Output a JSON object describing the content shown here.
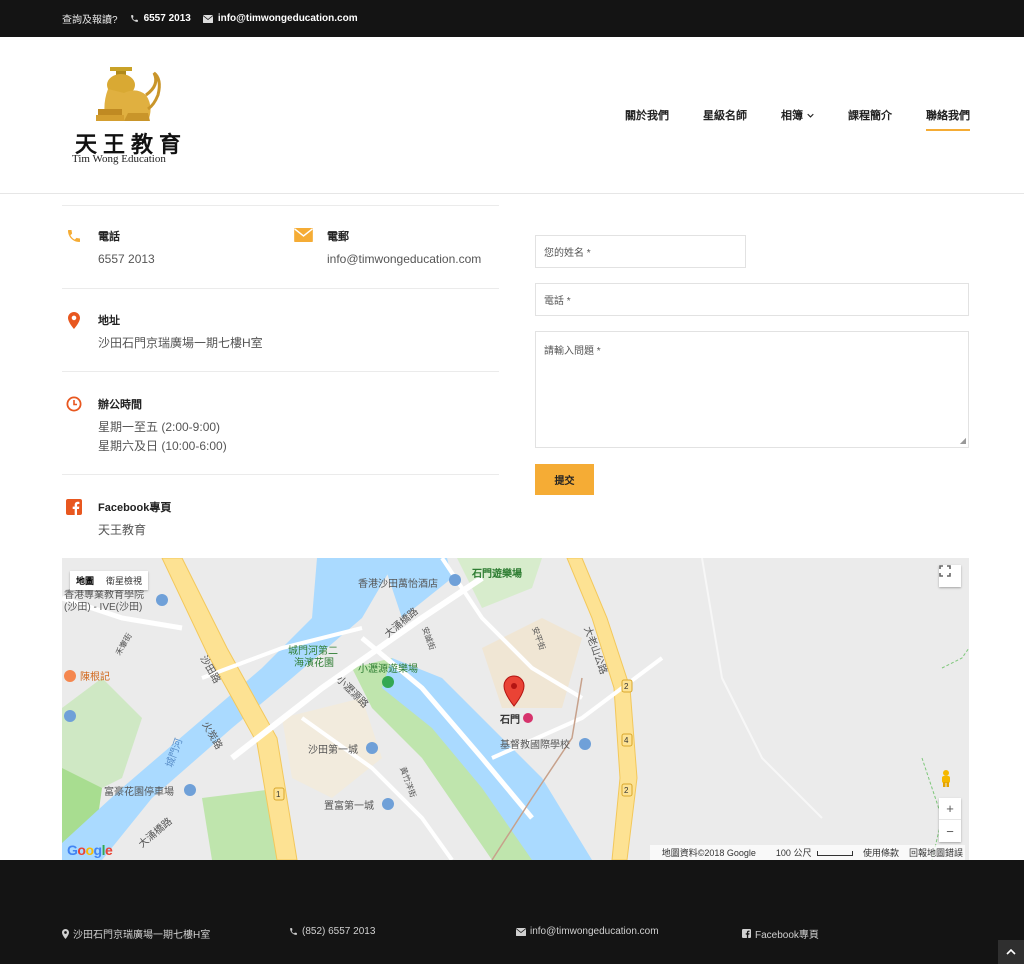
{
  "topbar": {
    "enquiry": "查詢及報讀?",
    "phone": "6557 2013",
    "email": "info@timwongeducation.com"
  },
  "logo": {
    "cn": "天王教育",
    "en": "Tim Wong Education"
  },
  "nav": [
    {
      "label": "關於我們"
    },
    {
      "label": "星級名師"
    },
    {
      "label": "相簿"
    },
    {
      "label": "課程簡介"
    },
    {
      "label": "聯絡我們"
    }
  ],
  "info": {
    "phone_label": "電話",
    "phone_value": "6557 2013",
    "email_label": "電郵",
    "email_value": "info@timwongeducation.com",
    "address_label": "地址",
    "address_value": "沙田石門京瑞廣場一期七樓H室",
    "hours_label": "辦公時間",
    "hours_weekday": "星期一至五 (2:00-9:00)",
    "hours_weekend": "星期六及日 (10:00-6:00)",
    "facebook_label": "Facebook專頁",
    "facebook_value": "天王教育"
  },
  "form": {
    "name_placeholder": "您的姓名 *",
    "phone_placeholder": "電話 *",
    "question_placeholder": "請輸入問題 *",
    "submit_label": "提交"
  },
  "map": {
    "type_map": "地圖",
    "type_satellite": "衛星檢視",
    "labels": {
      "ive": "香港專業教育學院",
      "ive2": "(沙田) - IVE(沙田)",
      "hotel": "香港沙田萬怡酒店",
      "park_game": "石門遊樂場",
      "garden": "城門河第二",
      "garden2": "海濱花園",
      "siulek": "小瀝源遊樂場",
      "road_shatin": "沙田路",
      "road_taichung": "大涌橋路",
      "road_taiolau": "大老山公路",
      "road_siulek": "小瀝源路",
      "road_fotan": "火炭路",
      "river": "城門河",
      "chan": "陳根記",
      "stonegate": "石門",
      "school": "基督教國際學校",
      "shatin_first": "沙田第一城",
      "fuhao": "富豪花園停車場",
      "fuyuan": "置富第一城",
      "road_tai_chung2": "大涌橋路",
      "road_on_ping": "安平街",
      "road_on_shing": "安誠街",
      "road_wong_chuk": "黃竹洋街",
      "road_wo_che": "禾輋街"
    },
    "footer_data": "地圖資料©2018 Google",
    "footer_scale": "100 公尺",
    "footer_terms": "使用條款",
    "footer_report": "回報地圖錯誤",
    "google": "Google"
  },
  "footer": {
    "address": "沙田石門京瑞廣場一期七樓H室",
    "phone": "(852) 6557 2013",
    "email": "info@timwongeducation.com",
    "facebook": "Facebook專頁"
  },
  "colors": {
    "accent": "#f5ac35",
    "dark": "#141414"
  }
}
